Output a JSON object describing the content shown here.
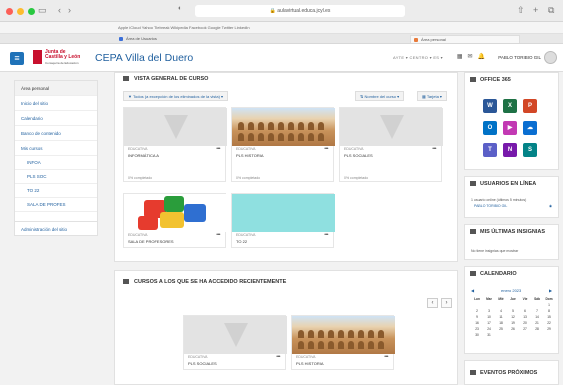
{
  "browser": {
    "url": "aulavirtual.educa.jcyl.es",
    "bookmarks": "Apple  iCloud  Yahoo  Tiebreak  Wikipedia  Facebook  Google  Twitter  LinkedIn",
    "tabs": [
      {
        "label": "Área de Usuarios",
        "color": "#3b6fd8"
      },
      {
        "label": "Área personal",
        "color": "#e87a3a"
      }
    ]
  },
  "header": {
    "site_name": "CEPA Villa del Duero",
    "logo_line1": "Junta de\nCastilla y León",
    "logo_line2": "Consejería de Educación",
    "right_menu": "AYTE ▾  CENTRO ▾  ES ▾",
    "user_name": "PABLO TORIBIO GIL"
  },
  "nav": {
    "items": [
      {
        "label": "Área personal",
        "active": true,
        "sub": false
      },
      {
        "label": "Inicio del sitio",
        "active": false,
        "sub": false
      },
      {
        "label": "Calendario",
        "active": false,
        "sub": false
      },
      {
        "label": "Banco de contenido",
        "active": false,
        "sub": false
      },
      {
        "label": "Mis cursos",
        "active": false,
        "sub": false
      },
      {
        "label": "INFOA",
        "active": false,
        "sub": true
      },
      {
        "label": "PLS SOC",
        "active": false,
        "sub": true
      },
      {
        "label": "TO 22",
        "active": false,
        "sub": true
      },
      {
        "label": "SALA DE PROFES",
        "active": false,
        "sub": true
      }
    ],
    "admin": "Administración del sitio"
  },
  "overview": {
    "title": "VISTA GENERAL DE CURSO",
    "filter": "▼ Todos (a excepción de los eliminados de la vista) ▾",
    "sort": "⇅ Nombre del curso ▾",
    "view": "▦ Tarjeta ▾",
    "courses": [
      {
        "category": "EDUCATIVA",
        "name": "INFORMÁTICA A",
        "progress": "0% completado",
        "style": "grey"
      },
      {
        "category": "EDUCATIVA",
        "name": "PLS HISTORIA",
        "progress": "0% completado",
        "style": "colosseum"
      },
      {
        "category": "EDUCATIVA",
        "name": "PLS SOCIALES",
        "progress": "0% completado",
        "style": "grey"
      },
      {
        "category": "EDUCATIVA",
        "name": "SALA DE PROFESORES",
        "progress": "",
        "style": "puzzle"
      },
      {
        "category": "EDUCATIVA",
        "name": "TO 22",
        "progress": "",
        "style": "teal"
      }
    ]
  },
  "recent": {
    "title": "CURSOS A LOS QUE SE HA ACCEDIDO RECIENTEMENTE",
    "prev": "‹",
    "next": "›",
    "courses": [
      {
        "category": "EDUCATIVA",
        "name": "PLS SOCIALES",
        "style": "grey"
      },
      {
        "category": "EDUCATIVA",
        "name": "PLS HISTORIA",
        "style": "colosseum"
      }
    ]
  },
  "office": {
    "title": "OFFICE 365",
    "apps": [
      {
        "letter": "W",
        "color": "#2b5797"
      },
      {
        "letter": "X",
        "color": "#1e7145"
      },
      {
        "letter": "P",
        "color": "#d24726"
      },
      {
        "letter": "O",
        "color": "#0072c6"
      },
      {
        "letter": "▶",
        "color": "#c239b3"
      },
      {
        "letter": "☁",
        "color": "#0a6ed1"
      },
      {
        "letter": "T",
        "color": "#5b5fc7"
      },
      {
        "letter": "N",
        "color": "#7719aa"
      },
      {
        "letter": "S",
        "color": "#038387"
      }
    ]
  },
  "online": {
    "title": "USUARIOS EN LÍNEA",
    "text": "1 usuario online (últimos 5 minutos)",
    "user": "PABLO TORIBIO GIL"
  },
  "badges": {
    "title": "MIS ÚLTIMAS INSIGNIAS",
    "text": "No tiene insignias que mostrar"
  },
  "calendar": {
    "title": "CALENDARIO",
    "month": "enero 2023",
    "days": [
      "Lun",
      "Mar",
      "Mié",
      "Jue",
      "Vie",
      "Sáb",
      "Dom"
    ],
    "cells": [
      "",
      "",
      "",
      "",
      "",
      "",
      "1",
      "2",
      "3",
      "4",
      "5",
      "6",
      "7",
      "8",
      "9",
      "10",
      "11",
      "12",
      "13",
      "14",
      "15",
      "16",
      "17",
      "18",
      "19",
      "20",
      "21",
      "22",
      "23",
      "24",
      "25",
      "26",
      "27",
      "28",
      "29",
      "30",
      "31",
      "",
      "",
      "",
      "",
      ""
    ]
  },
  "events": {
    "title": "EVENTOS PRÓXIMOS"
  },
  "colors": {
    "accent": "#1f72b8",
    "link": "#1f5f9e"
  }
}
